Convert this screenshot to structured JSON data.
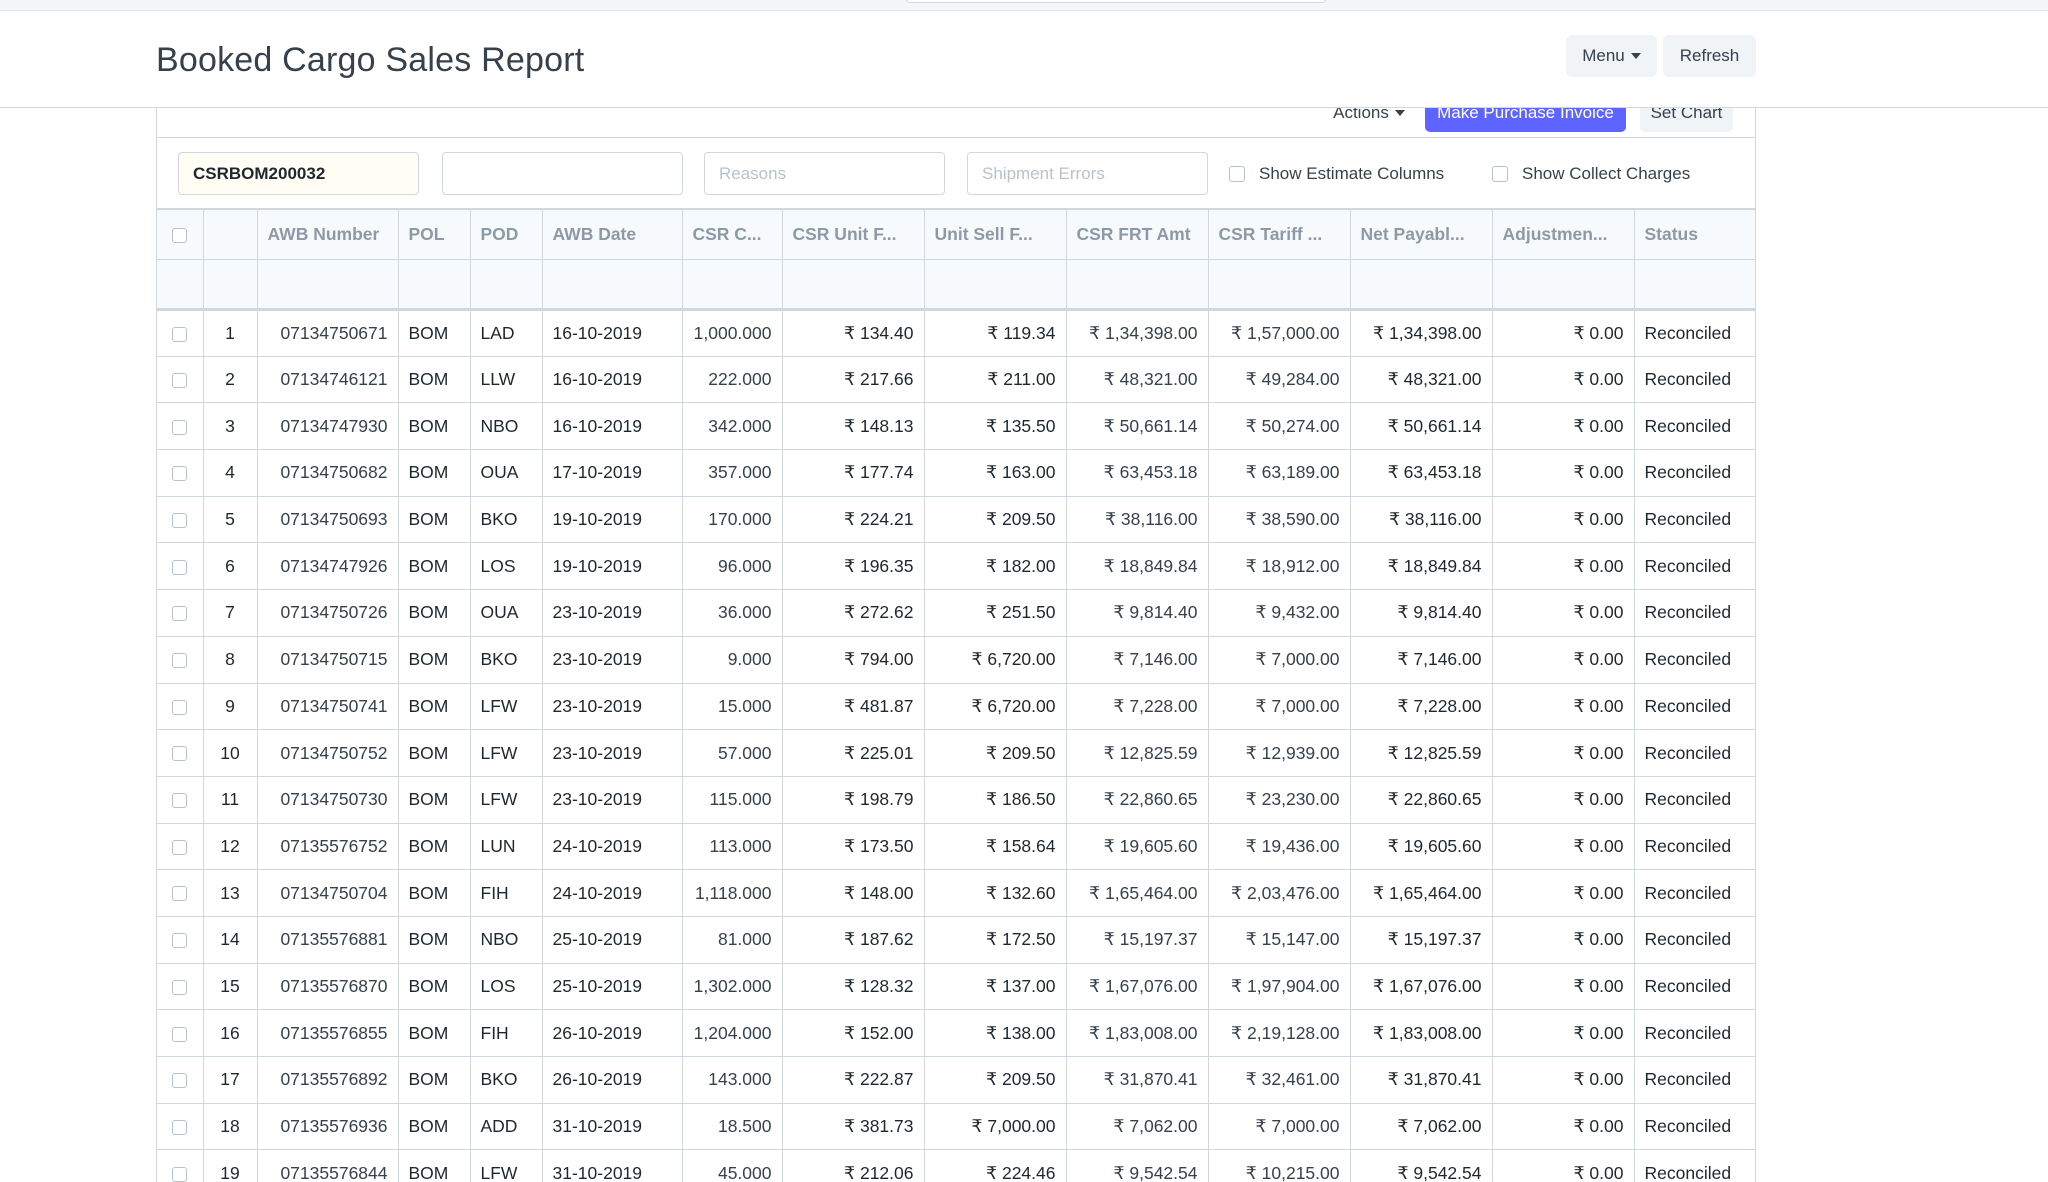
{
  "page": {
    "title": "Booked Cargo Sales Report"
  },
  "header_buttons": {
    "menu": "Menu",
    "refresh": "Refresh"
  },
  "actions": {
    "actions_label": "Actions",
    "purchase_label": "Make Purchase Invoice",
    "set_chart_label": "Set Chart"
  },
  "filters": {
    "awb_value": "CSRBOM200032",
    "field2_value": "",
    "reasons_placeholder": "Reasons",
    "shipment_errors_placeholder": "Shipment Errors",
    "show_estimate_label": "Show Estimate Columns",
    "show_collect_label": "Show Collect Charges"
  },
  "columns": [
    "AWB Number",
    "POL",
    "POD",
    "AWB Date",
    "CSR C...",
    "CSR Unit F...",
    "Unit Sell F...",
    "CSR FRT Amt",
    "CSR Tariff ...",
    "Net Payabl...",
    "Adjustmen...",
    "Status"
  ],
  "rows": [
    [
      "1",
      "07134750671",
      "BOM",
      "LAD",
      "16-10-2019",
      "1,000.000",
      "₹ 134.40",
      "₹ 119.34",
      "₹ 1,34,398.00",
      "₹ 1,57,000.00",
      "₹ 1,34,398.00",
      "₹ 0.00",
      "Reconciled"
    ],
    [
      "2",
      "07134746121",
      "BOM",
      "LLW",
      "16-10-2019",
      "222.000",
      "₹ 217.66",
      "₹ 211.00",
      "₹ 48,321.00",
      "₹ 49,284.00",
      "₹ 48,321.00",
      "₹ 0.00",
      "Reconciled"
    ],
    [
      "3",
      "07134747930",
      "BOM",
      "NBO",
      "16-10-2019",
      "342.000",
      "₹ 148.13",
      "₹ 135.50",
      "₹ 50,661.14",
      "₹ 50,274.00",
      "₹ 50,661.14",
      "₹ 0.00",
      "Reconciled"
    ],
    [
      "4",
      "07134750682",
      "BOM",
      "OUA",
      "17-10-2019",
      "357.000",
      "₹ 177.74",
      "₹ 163.00",
      "₹ 63,453.18",
      "₹ 63,189.00",
      "₹ 63,453.18",
      "₹ 0.00",
      "Reconciled"
    ],
    [
      "5",
      "07134750693",
      "BOM",
      "BKO",
      "19-10-2019",
      "170.000",
      "₹ 224.21",
      "₹ 209.50",
      "₹ 38,116.00",
      "₹ 38,590.00",
      "₹ 38,116.00",
      "₹ 0.00",
      "Reconciled"
    ],
    [
      "6",
      "07134747926",
      "BOM",
      "LOS",
      "19-10-2019",
      "96.000",
      "₹ 196.35",
      "₹ 182.00",
      "₹ 18,849.84",
      "₹ 18,912.00",
      "₹ 18,849.84",
      "₹ 0.00",
      "Reconciled"
    ],
    [
      "7",
      "07134750726",
      "BOM",
      "OUA",
      "23-10-2019",
      "36.000",
      "₹ 272.62",
      "₹ 251.50",
      "₹ 9,814.40",
      "₹ 9,432.00",
      "₹ 9,814.40",
      "₹ 0.00",
      "Reconciled"
    ],
    [
      "8",
      "07134750715",
      "BOM",
      "BKO",
      "23-10-2019",
      "9.000",
      "₹ 794.00",
      "₹ 6,720.00",
      "₹ 7,146.00",
      "₹ 7,000.00",
      "₹ 7,146.00",
      "₹ 0.00",
      "Reconciled"
    ],
    [
      "9",
      "07134750741",
      "BOM",
      "LFW",
      "23-10-2019",
      "15.000",
      "₹ 481.87",
      "₹ 6,720.00",
      "₹ 7,228.00",
      "₹ 7,000.00",
      "₹ 7,228.00",
      "₹ 0.00",
      "Reconciled"
    ],
    [
      "10",
      "07134750752",
      "BOM",
      "LFW",
      "23-10-2019",
      "57.000",
      "₹ 225.01",
      "₹ 209.50",
      "₹ 12,825.59",
      "₹ 12,939.00",
      "₹ 12,825.59",
      "₹ 0.00",
      "Reconciled"
    ],
    [
      "11",
      "07134750730",
      "BOM",
      "LFW",
      "23-10-2019",
      "115.000",
      "₹ 198.79",
      "₹ 186.50",
      "₹ 22,860.65",
      "₹ 23,230.00",
      "₹ 22,860.65",
      "₹ 0.00",
      "Reconciled"
    ],
    [
      "12",
      "07135576752",
      "BOM",
      "LUN",
      "24-10-2019",
      "113.000",
      "₹ 173.50",
      "₹ 158.64",
      "₹ 19,605.60",
      "₹ 19,436.00",
      "₹ 19,605.60",
      "₹ 0.00",
      "Reconciled"
    ],
    [
      "13",
      "07134750704",
      "BOM",
      "FIH",
      "24-10-2019",
      "1,118.000",
      "₹ 148.00",
      "₹ 132.60",
      "₹ 1,65,464.00",
      "₹ 2,03,476.00",
      "₹ 1,65,464.00",
      "₹ 0.00",
      "Reconciled"
    ],
    [
      "14",
      "07135576881",
      "BOM",
      "NBO",
      "25-10-2019",
      "81.000",
      "₹ 187.62",
      "₹ 172.50",
      "₹ 15,197.37",
      "₹ 15,147.00",
      "₹ 15,197.37",
      "₹ 0.00",
      "Reconciled"
    ],
    [
      "15",
      "07135576870",
      "BOM",
      "LOS",
      "25-10-2019",
      "1,302.000",
      "₹ 128.32",
      "₹ 137.00",
      "₹ 1,67,076.00",
      "₹ 1,97,904.00",
      "₹ 1,67,076.00",
      "₹ 0.00",
      "Reconciled"
    ],
    [
      "16",
      "07135576855",
      "BOM",
      "FIH",
      "26-10-2019",
      "1,204.000",
      "₹ 152.00",
      "₹ 138.00",
      "₹ 1,83,008.00",
      "₹ 2,19,128.00",
      "₹ 1,83,008.00",
      "₹ 0.00",
      "Reconciled"
    ],
    [
      "17",
      "07135576892",
      "BOM",
      "BKO",
      "26-10-2019",
      "143.000",
      "₹ 222.87",
      "₹ 209.50",
      "₹ 31,870.41",
      "₹ 32,461.00",
      "₹ 31,870.41",
      "₹ 0.00",
      "Reconciled"
    ],
    [
      "18",
      "07135576936",
      "BOM",
      "ADD",
      "31-10-2019",
      "18.500",
      "₹ 381.73",
      "₹ 7,000.00",
      "₹ 7,062.00",
      "₹ 7,000.00",
      "₹ 7,062.00",
      "₹ 0.00",
      "Reconciled"
    ],
    [
      "19",
      "07135576844",
      "BOM",
      "LFW",
      "31-10-2019",
      "45.000",
      "₹ 212.06",
      "₹ 224.46",
      "₹ 9,542.54",
      "₹ 10,215.00",
      "₹ 9,542.54",
      "₹ 0.00",
      "Reconciled"
    ]
  ],
  "colors": {
    "primary": "#5e64ff",
    "border": "#d1d8dd",
    "header_text": "#8d99a6",
    "text": "#36414c"
  }
}
